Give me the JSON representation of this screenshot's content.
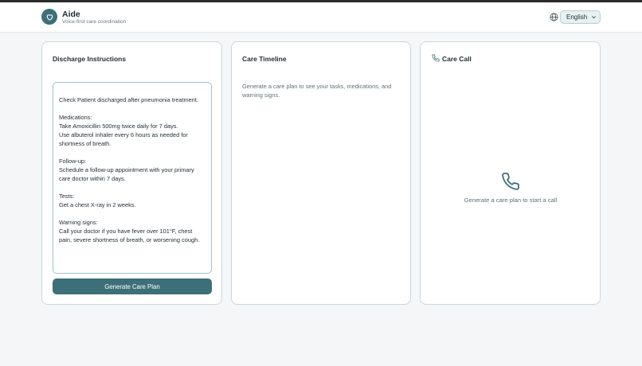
{
  "app": {
    "name": "Aide",
    "tagline": "Voice-first care coordination",
    "language": "English",
    "icons": {
      "logo": "heart-icon",
      "language": "globe-icon",
      "dropdown": "chevron-down-icon",
      "call": "phone-icon"
    },
    "colors": {
      "accent": "#3d6f78",
      "border": "#c9d8dc",
      "background": "#f4f6f7"
    }
  },
  "discharge": {
    "title": "Discharge Instructions",
    "text": "Check Patient discharged after pneumonia treatment.\n\nMedications:\nTake Amoxicillin 500mg twice daily for 7 days.\nUse albuterol inhaler every 6 hours as needed for shortness of breath.\n\nFollow-up:\nSchedule a follow-up appointment with your primary care doctor within 7 days.\n\nTests:\nGet a chest X-ray in 2 weeks.\n\nWarning signs:\nCall your doctor if you have fever over 101°F, chest pain, severe shortness of breath, or worsening cough.",
    "button_label": "Generate Care Plan"
  },
  "timeline": {
    "title": "Care Timeline",
    "empty_message": "Generate a care plan to see your tasks, medications, and warning signs."
  },
  "call": {
    "title": "Care Call",
    "empty_message": "Generate a care plan to start a call"
  }
}
